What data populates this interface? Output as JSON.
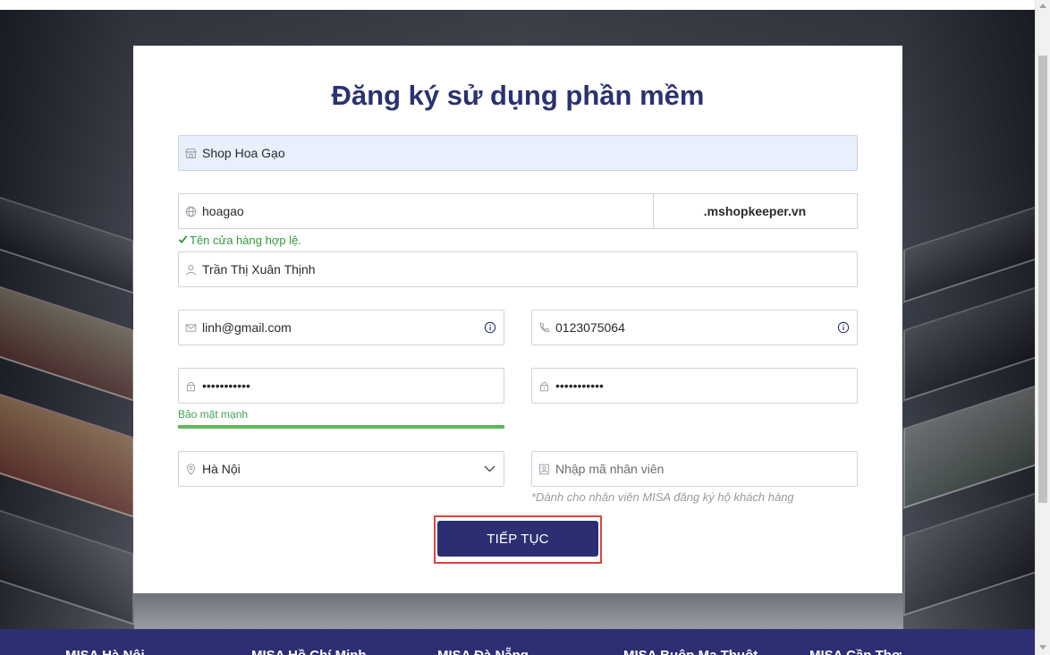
{
  "page": {
    "title": "Đăng ký sử dụng phần mềm"
  },
  "form": {
    "shop_name": {
      "value": "Shop Hoa Gạo",
      "icon": "store-icon"
    },
    "domain": {
      "value": "hoagao",
      "suffix": ".mshopkeeper.vn",
      "icon": "globe-icon",
      "validation_message": "Tên cửa hàng hợp lệ."
    },
    "full_name": {
      "value": "Trần Thị Xuân Thịnh",
      "icon": "user-icon"
    },
    "email": {
      "value": "linh@gmail.com",
      "icon": "mail-icon"
    },
    "phone": {
      "value": "0123075064",
      "icon": "phone-icon"
    },
    "password": {
      "value": "•••••••••••",
      "icon": "lock-icon",
      "strength_label": "Bảo mật mạnh",
      "strength_fraction": 1.0
    },
    "confirm_password": {
      "value": "•••••••••••",
      "icon": "lock-icon"
    },
    "province": {
      "value": "Hà Nội",
      "icon": "location-pin-icon"
    },
    "employee_code": {
      "placeholder": "Nhập mã nhân viên",
      "icon": "id-card-icon",
      "note": "*Dành cho nhân viên MISA đăng ký hộ khách hàng"
    },
    "submit_label": "TIẾP TỤC"
  },
  "footer": {
    "items": [
      "MISA Hà Nội",
      "MISA Hồ Chí Minh",
      "MISA Đà Nẵng",
      "MISA Buôn Ma Thuột",
      "MISA Cần Thơ"
    ]
  },
  "colors": {
    "accent": "#2b2f72",
    "title": "#2b3270",
    "success": "#2e9a3b",
    "highlight_border": "#e0443a"
  }
}
